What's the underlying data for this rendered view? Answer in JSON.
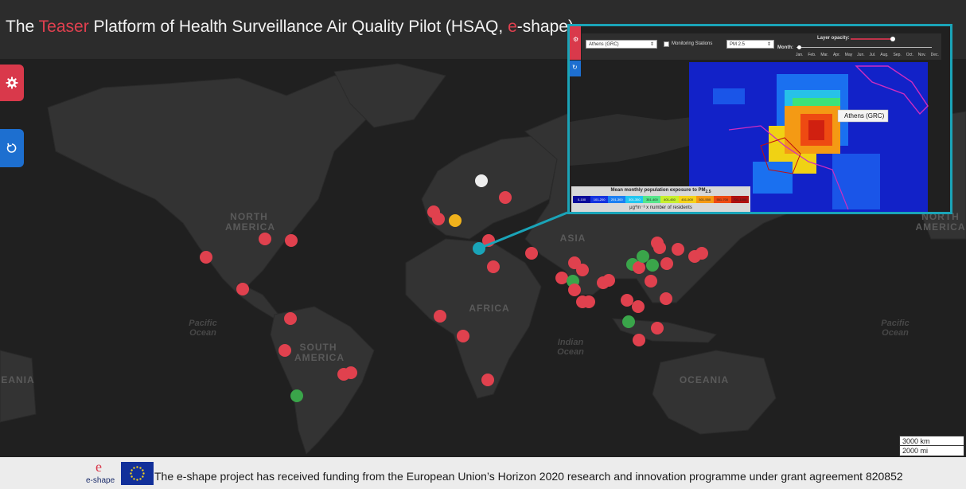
{
  "header": {
    "title_pre": "The ",
    "title_teaser": "Teaser",
    "title_mid": " Platform of Health Surveillance Air Quality Pilot (HSAQ, ",
    "title_e": "e",
    "title_post": "-shape)"
  },
  "map_labels": {
    "north_america": "NORTH\nAMERICA",
    "south_america": "SOUTH\nAMERICA",
    "africa": "AFRICA",
    "asia": "ASIA",
    "oceania": "OCEANIA",
    "oceania_left": "EANIA",
    "north_america_right": "NORTH\nAMERICA",
    "pacific_left": "Pacific\nOcean",
    "pacific_right": "Pacific\nOcean",
    "indian": "Indian\nOcean"
  },
  "inset": {
    "city_select": "Athens (GRC)",
    "monitoring_label": "Monitoring Stations",
    "pollutant_select": "PM 2.5",
    "opacity_label": "Layer opacity:",
    "month_label": "Month:",
    "months": [
      "Jan.",
      "Feb.",
      "Mar.",
      "Apr.",
      "May",
      "Jun.",
      "Jul.",
      "Aug.",
      "Sep.",
      "Oct.",
      "Nov.",
      "Dec."
    ],
    "popup": "Athens (GRC)",
    "legend_title": "Mean monthly population exposure to PM",
    "legend_title_sub": "2.5",
    "legend_units": "μg*m⁻³ x number of residents",
    "legend_bins": [
      "0-100",
      "101-200",
      "201-300",
      "301-350",
      "351-400",
      "401-450",
      "451-500",
      "501-550",
      "551-700",
      "701-1000"
    ],
    "legend_colors": [
      "#0a0a9a",
      "#1433e0",
      "#1c7ff2",
      "#22c6f0",
      "#55e68a",
      "#c8ef2e",
      "#f5d21a",
      "#f59a14",
      "#ee4a12",
      "#b01010"
    ]
  },
  "scale": {
    "km": "3000 km",
    "mi": "2000 mi"
  },
  "footer": {
    "logo_text": "e-shape",
    "text": "The e-shape project has received funding from the European Union’s Horizon 2020 research and innovation programme under grant agreement 820852"
  },
  "colors": {
    "accent_red": "#d9394b",
    "accent_blue": "#1d6fd0",
    "inset_border": "#1aa4b8"
  }
}
